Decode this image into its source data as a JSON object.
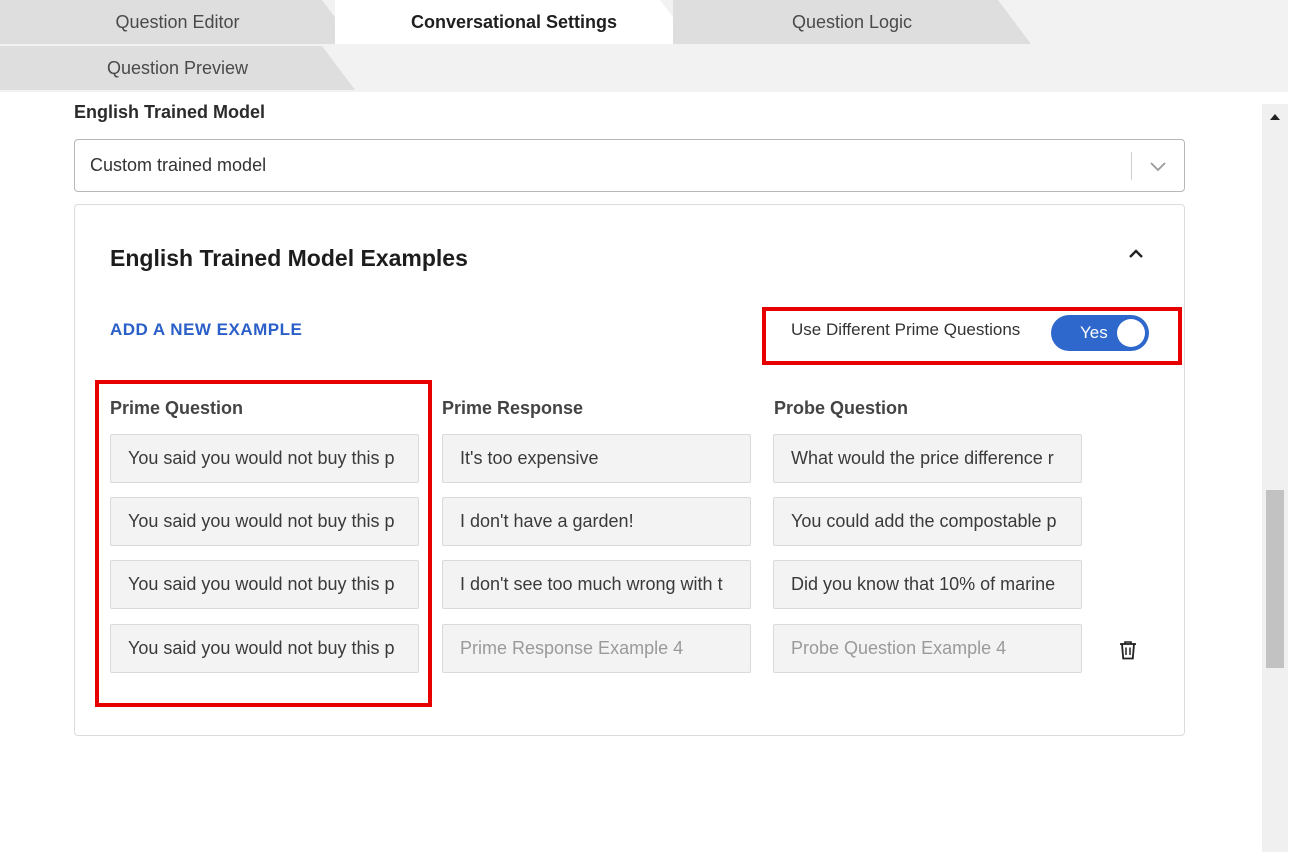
{
  "tabs": [
    {
      "label": "Question Editor",
      "active": false
    },
    {
      "label": "Conversational Settings",
      "active": true
    },
    {
      "label": "Question Logic",
      "active": false
    },
    {
      "label": "Question Preview",
      "active": false
    }
  ],
  "model": {
    "label": "English Trained Model",
    "selected": "Custom trained model"
  },
  "examples": {
    "title": "English Trained Model Examples",
    "add_label": "ADD A NEW EXAMPLE",
    "toggle_label": "Use Different Prime Questions",
    "toggle_value": "Yes",
    "columns": [
      "Prime Question",
      "Prime Response",
      "Probe Question"
    ],
    "rows": [
      {
        "prime_question": "You said you would not buy this p",
        "prime_response": "It's too expensive",
        "probe_question": "What would the price difference r"
      },
      {
        "prime_question": "You said you would not buy this p",
        "prime_response": "I don't have a garden!",
        "probe_question": "You could add the compostable p"
      },
      {
        "prime_question": "You said you would not buy this p",
        "prime_response": "I don't see too much wrong with t",
        "probe_question": "Did you know that 10% of marine"
      },
      {
        "prime_question": "You said you would not buy this p",
        "prime_response_placeholder": "Prime Response Example 4",
        "probe_question_placeholder": "Probe Question Example 4"
      }
    ]
  },
  "colors": {
    "accent": "#2e68cc",
    "link": "#2b5fc8",
    "highlight": "#e60000"
  },
  "icons": [
    "chevron-down-icon",
    "chevron-up-icon",
    "trash-icon",
    "scroll-up-arrow-icon"
  ]
}
